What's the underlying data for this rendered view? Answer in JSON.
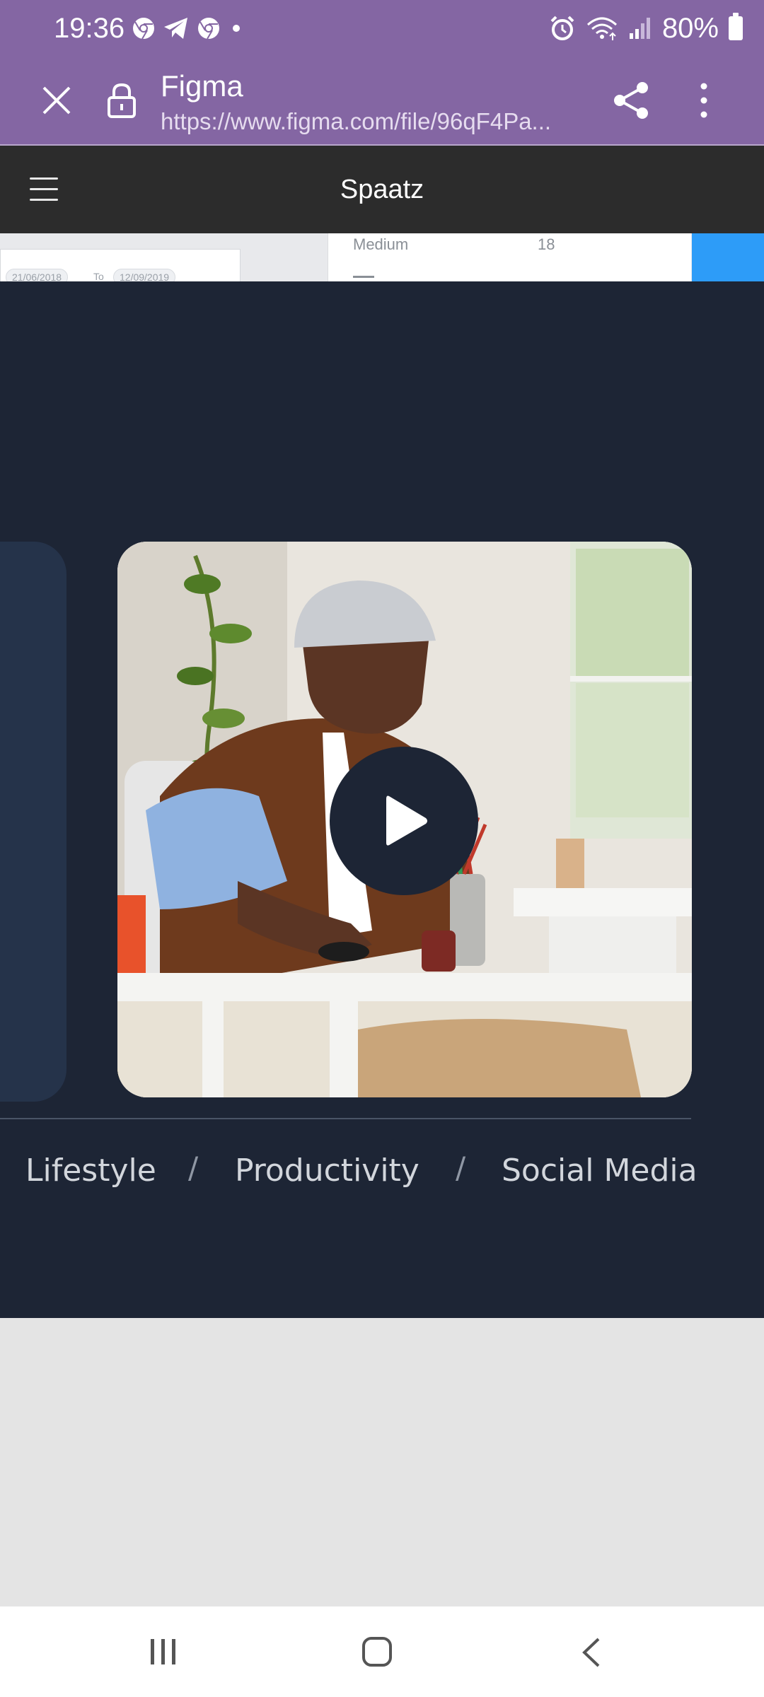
{
  "status_bar": {
    "time": "19:36",
    "battery": "80%",
    "notification_icons": [
      "chrome-icon",
      "telegram-icon",
      "chrome-icon",
      "dot-icon"
    ],
    "right_icons": [
      "alarm-icon",
      "wifi-icon",
      "signal-icon",
      "battery-icon"
    ]
  },
  "browser": {
    "title": "Figma",
    "url": "https://www.figma.com/file/96qF4Pa...",
    "close_icon": "close-icon",
    "lock_icon": "lock-icon",
    "share_icon": "share-icon",
    "menu_icon": "more-vert-icon",
    "bar_color": "#8466a3"
  },
  "prototype": {
    "title": "Spaatz",
    "menu_icon": "hamburger-icon"
  },
  "canvas_strip": {
    "pill_from": "21/06/2018",
    "pill_to_label": "To",
    "pill_to": "12/09/2019",
    "medium_label": "Medium",
    "medium_value": "18"
  },
  "content": {
    "background": "#1d2535",
    "video_alt": "Man in beanie working at a desk with a computer mouse",
    "play_icon": "play-icon",
    "categories": [
      "Lifestyle",
      "Productivity",
      "Social Media"
    ],
    "separator": "/"
  },
  "nav_bar": {
    "icons": [
      "recents-icon",
      "home-icon",
      "back-icon"
    ]
  }
}
